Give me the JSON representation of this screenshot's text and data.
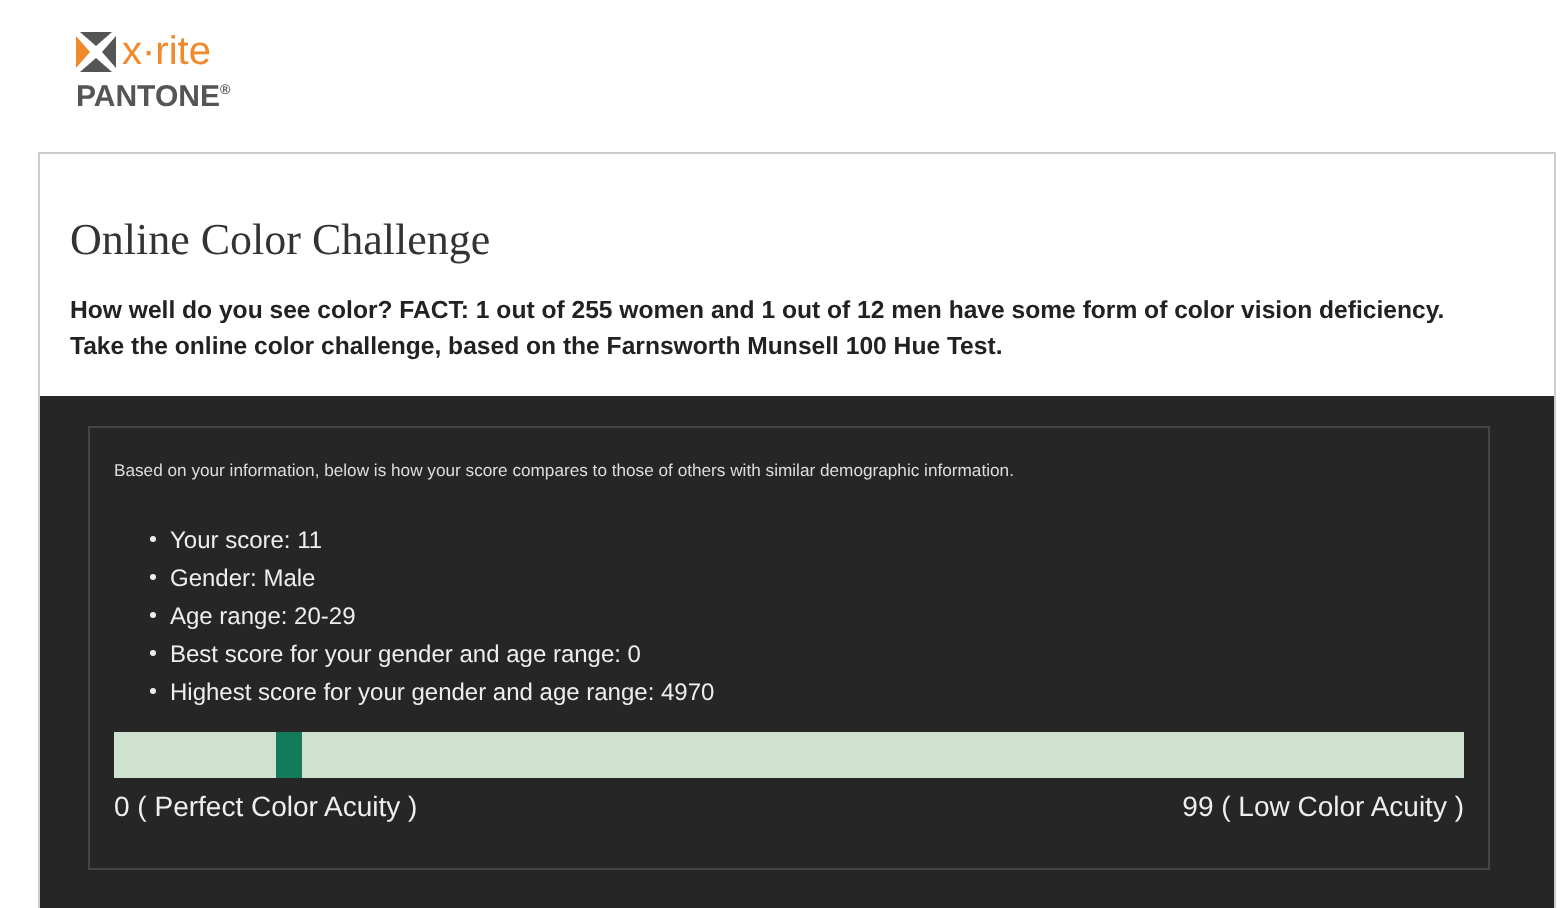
{
  "brand": {
    "name": "x·rite",
    "sub": "PANTONE",
    "sub_mark": "®"
  },
  "header": {
    "title": "Online Color Challenge",
    "intro": [
      "How well do you see color? FACT: 1 out of 255 women and 1 out of 12 men have some form of color vision deficiency.",
      "Take the online color challenge, based on the Farnsworth Munsell 100 Hue Test."
    ]
  },
  "results": {
    "note": "Based on your information, below is how your score compares to those of others with similar demographic information.",
    "items": [
      "Your score: 11",
      "Gender: Male",
      "Age range: 20-29",
      "Best score for your gender and age range: 0",
      "Highest score for your gender and age range: 4970"
    ],
    "scale": {
      "level": 0.12,
      "min_label": "0 ( Perfect Color Acuity )",
      "max_label": "99 ( Low Color Acuity )"
    }
  }
}
